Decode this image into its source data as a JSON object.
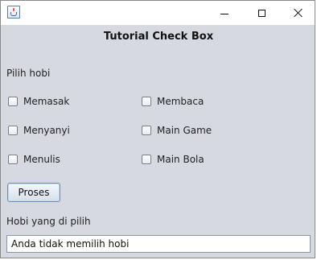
{
  "window": {
    "title": "",
    "icon": "java-cup-icon"
  },
  "form": {
    "heading": "Tutorial Check Box",
    "prompt_label": "Pilih hobi",
    "checkboxes": [
      {
        "label": "Memasak",
        "checked": false
      },
      {
        "label": "Membaca",
        "checked": false
      },
      {
        "label": "Menyanyi",
        "checked": false
      },
      {
        "label": "Main Game",
        "checked": false
      },
      {
        "label": "Menulis",
        "checked": false
      },
      {
        "label": "Main Bola",
        "checked": false
      }
    ],
    "submit_label": "Proses",
    "result_label": "Hobi yang di pilih",
    "result_value": "Anda tidak memilih hobi"
  },
  "colors": {
    "background": "#d6d9df",
    "titlebar": "#ffffff",
    "button_border": "#6f8db3"
  }
}
